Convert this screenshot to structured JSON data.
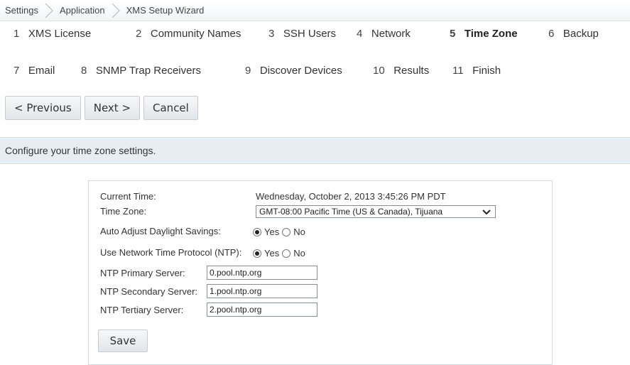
{
  "breadcrumb": [
    "Settings",
    "Application",
    "XMS Setup Wizard"
  ],
  "steps": [
    {
      "num": "1",
      "label": "XMS License"
    },
    {
      "num": "2",
      "label": "Community Names"
    },
    {
      "num": "3",
      "label": "SSH Users"
    },
    {
      "num": "4",
      "label": "Network"
    },
    {
      "num": "5",
      "label": "Time Zone",
      "active": true
    },
    {
      "num": "6",
      "label": "Backup"
    },
    {
      "num": "7",
      "label": "Email"
    },
    {
      "num": "8",
      "label": "SNMP Trap Receivers"
    },
    {
      "num": "9",
      "label": "Discover Devices"
    },
    {
      "num": "10",
      "label": "Results"
    },
    {
      "num": "11",
      "label": "Finish"
    }
  ],
  "nav": {
    "previous": "< Previous",
    "next": "Next >",
    "cancel": "Cancel"
  },
  "info": "Configure your time zone settings.",
  "form": {
    "current_time_label": "Current Time:",
    "current_time_value": "Wednesday, October 2, 2013 3:45:26 PM PDT",
    "time_zone_label": "Time Zone:",
    "time_zone_value": "GMT-08:00 Pacific Time (US & Canada), Tijuana",
    "daylight_label": "Auto Adjust Daylight Savings:",
    "ntp_label": "Use Network Time Protocol (NTP):",
    "yes": "Yes",
    "no": "No",
    "daylight_selected": "Yes",
    "ntp_selected": "Yes",
    "primary_label": "NTP Primary Server:",
    "primary_value": "0.pool.ntp.org",
    "secondary_label": "NTP Secondary Server:",
    "secondary_value": "1.pool.ntp.org",
    "tertiary_label": "NTP Tertiary Server:",
    "tertiary_value": "2.pool.ntp.org",
    "save": "Save"
  }
}
